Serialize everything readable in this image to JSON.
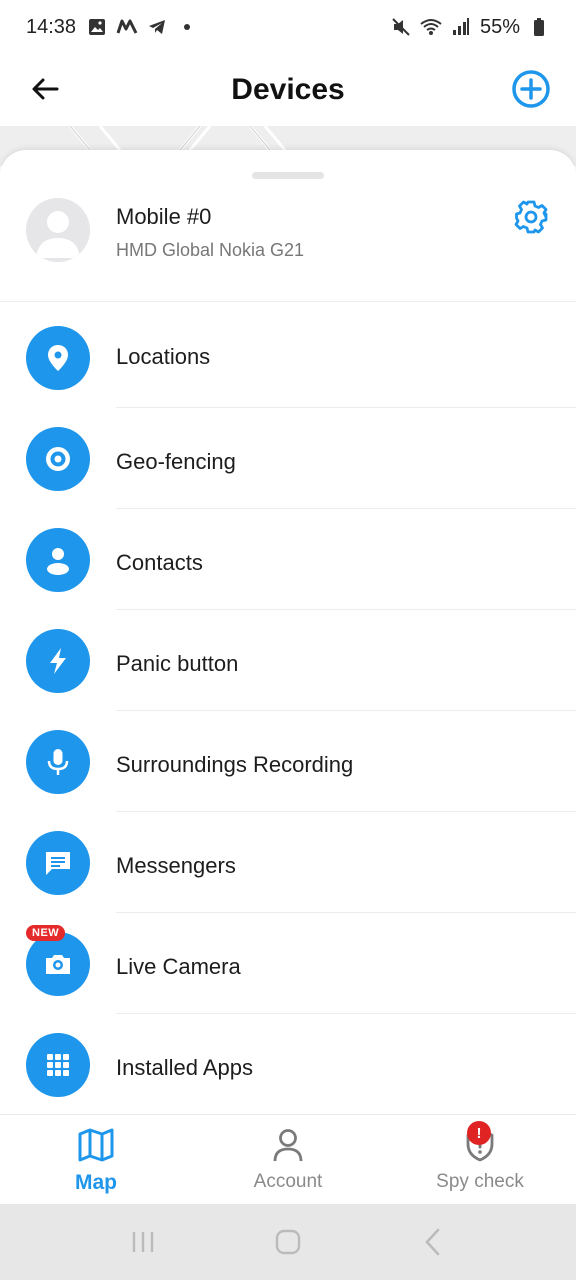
{
  "status_bar": {
    "time": "14:38",
    "battery": "55%",
    "icons": [
      "image-icon",
      "maps-icon",
      "telegram-icon",
      "dot-icon",
      "mute-icon",
      "wifi-icon",
      "signal-icon",
      "battery-icon"
    ]
  },
  "header": {
    "title": "Devices",
    "back_icon": "arrow-left-icon",
    "add_icon": "plus-circle-icon"
  },
  "device": {
    "name": "Mobile #0",
    "model": "HMD Global Nokia G21",
    "settings_icon": "gear-icon"
  },
  "menu": {
    "items": [
      {
        "label": "Locations",
        "icon": "location-pin-icon"
      },
      {
        "label": "Geo-fencing",
        "icon": "target-icon"
      },
      {
        "label": "Contacts",
        "icon": "person-icon"
      },
      {
        "label": "Panic button",
        "icon": "lightning-icon"
      },
      {
        "label": "Surroundings Recording",
        "icon": "microphone-icon"
      },
      {
        "label": "Messengers",
        "icon": "chat-icon"
      },
      {
        "label": "Live Camera",
        "icon": "camera-icon",
        "badge": "NEW"
      },
      {
        "label": "Installed Apps",
        "icon": "grid-apps-icon"
      }
    ]
  },
  "bottom_nav": {
    "items": [
      {
        "label": "Map",
        "icon": "map-icon",
        "active": true
      },
      {
        "label": "Account",
        "icon": "person-outline-icon",
        "active": false
      },
      {
        "label": "Spy check",
        "icon": "shield-icon",
        "active": false,
        "alert": "!"
      }
    ]
  },
  "colors": {
    "accent": "#1e96ec",
    "alert": "#e02424",
    "badge_new": "#e42a2a"
  }
}
